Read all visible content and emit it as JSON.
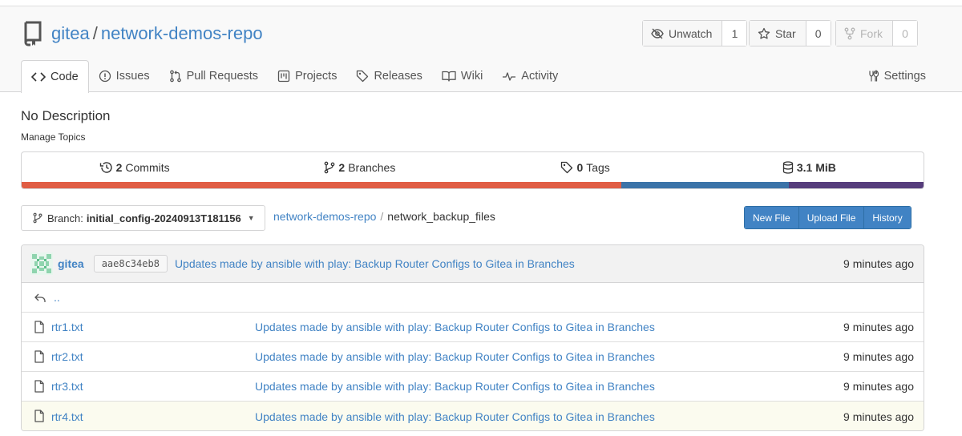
{
  "repo": {
    "owner": "gitea",
    "separator": "/",
    "name": "network-demos-repo"
  },
  "actions": {
    "watch": {
      "label": "Unwatch",
      "count": "1"
    },
    "star": {
      "label": "Star",
      "count": "0"
    },
    "fork": {
      "label": "Fork",
      "count": "0"
    }
  },
  "tabs": [
    {
      "label": "Code",
      "icon": "code-icon"
    },
    {
      "label": "Issues",
      "icon": "issue-opened-icon"
    },
    {
      "label": "Pull Requests",
      "icon": "git-pull-request-icon"
    },
    {
      "label": "Projects",
      "icon": "project-icon"
    },
    {
      "label": "Releases",
      "icon": "tag-icon"
    },
    {
      "label": "Wiki",
      "icon": "book-icon"
    },
    {
      "label": "Activity",
      "icon": "pulse-icon"
    }
  ],
  "settings_label": "Settings",
  "description": "No Description",
  "manage_topics": "Manage Topics",
  "stats": {
    "commits": {
      "count": "2",
      "label": "Commits"
    },
    "branches": {
      "count": "2",
      "label": "Branches"
    },
    "tags": {
      "count": "0",
      "label": "Tags"
    },
    "size": "3.1 MiB"
  },
  "language_bar": [
    {
      "color": "#e05d44",
      "fraction": 0.665
    },
    {
      "color": "#3b73a8",
      "fraction": 0.186
    },
    {
      "color": "#563d7c",
      "fraction": 0.149
    }
  ],
  "branch": {
    "prefix": "Branch:",
    "name": "initial_config-20240913T181156"
  },
  "breadcrumb": {
    "root": "network-demos-repo",
    "sep": "/",
    "current": "network_backup_files"
  },
  "buttons": {
    "new_file": "New File",
    "upload_file": "Upload File",
    "history": "History"
  },
  "latest_commit": {
    "author": "gitea",
    "sha": "aae8c34eb8",
    "message": "Updates made by ansible with play: Backup Router Configs to Gitea in Branches",
    "time": "9 minutes ago"
  },
  "parent_dir": "..",
  "files": [
    {
      "name": "rtr1.txt",
      "message": "Updates made by ansible with play: Backup Router Configs to Gitea in Branches",
      "time": "9 minutes ago"
    },
    {
      "name": "rtr2.txt",
      "message": "Updates made by ansible with play: Backup Router Configs to Gitea in Branches",
      "time": "9 minutes ago"
    },
    {
      "name": "rtr3.txt",
      "message": "Updates made by ansible with play: Backup Router Configs to Gitea in Branches",
      "time": "9 minutes ago"
    },
    {
      "name": "rtr4.txt",
      "message": "Updates made by ansible with play: Backup Router Configs to Gitea in Branches",
      "time": "9 minutes ago"
    }
  ]
}
